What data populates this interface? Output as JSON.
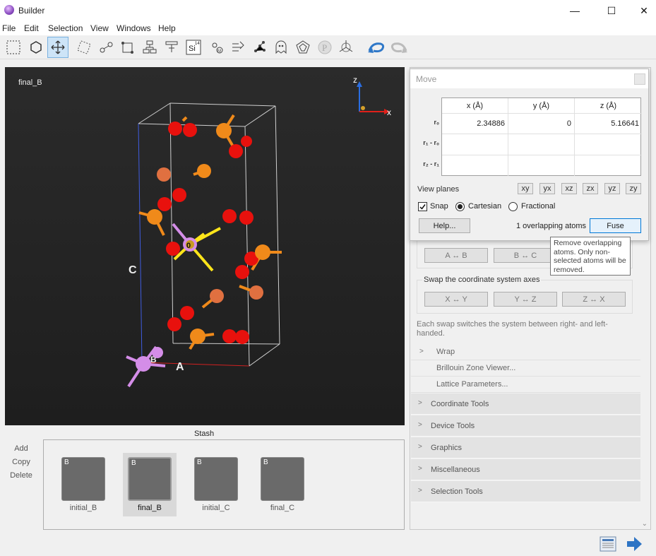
{
  "window": {
    "title": "Builder",
    "minimize": "—",
    "maximize": "☐",
    "close": "✕"
  },
  "menu": [
    "File",
    "Edit",
    "Selection",
    "View",
    "Windows",
    "Help"
  ],
  "toolbar": {
    "icons": [
      "select-rectangle-icon",
      "rotate-icon",
      "move-icon",
      "tag-icon",
      "bond-icon",
      "cell-icon",
      "tree-icon",
      "builder-icon",
      "periodic-table-icon",
      "molecule-icon",
      "transform-icon",
      "graph-icon",
      "ghost-icon",
      "crystal-icon",
      "quantum-icon",
      "axes-icon",
      "undo-icon",
      "redo-icon"
    ],
    "element_symbol": "Si",
    "element_number": "14"
  },
  "viewport": {
    "label": "final_B",
    "axis_z": "z",
    "axis_x": "x",
    "lattice_c": "C",
    "lattice_a": "A",
    "lattice_b": "B",
    "origin_label": "0"
  },
  "stash": {
    "title": "Stash",
    "actions": [
      "Add",
      "Copy",
      "Delete"
    ],
    "items": [
      {
        "name": "initial_B",
        "badge": "B",
        "selected": false
      },
      {
        "name": "final_B",
        "badge": "B",
        "selected": true
      },
      {
        "name": "initial_C",
        "badge": "B",
        "selected": false
      },
      {
        "name": "final_C",
        "badge": "B",
        "selected": false
      }
    ]
  },
  "move_dialog": {
    "title": "Move",
    "columns": [
      "x (Å)",
      "y (Å)",
      "z (Å)"
    ],
    "rows": [
      {
        "label": "r₀",
        "values": [
          "2.34886",
          "0",
          "5.16641"
        ]
      },
      {
        "label": "r₁ - r₀",
        "values": [
          "",
          "",
          ""
        ]
      },
      {
        "label": "r₂ - r₁",
        "values": [
          "",
          "",
          ""
        ]
      }
    ],
    "view_planes_label": "View planes",
    "view_planes": [
      "xy",
      "yx",
      "xz",
      "zx",
      "yz",
      "zy"
    ],
    "snap_label": "Snap",
    "snap_checked": true,
    "cartesian_label": "Cartesian",
    "fractional_label": "Fractional",
    "coordinate_mode": "Cartesian",
    "help_button": "Help...",
    "overlap_text": "1 overlapping atoms",
    "fuse_button": "Fuse"
  },
  "tooltip": {
    "text": "Remove overlapping atoms. Only non-selected atoms will be removed."
  },
  "right_panel": {
    "swap_lattice": [
      "A ↔ B",
      "B ↔ C"
    ],
    "swap_axes_title": "Swap the coordinate system axes",
    "swap_axes": [
      "X ↔ Y",
      "Y ↔ Z",
      "Z ↔ X"
    ],
    "swap_hint": "Each swap switches the system between right- and left-handed.",
    "subitems": [
      "Wrap",
      "Brillouin Zone Viewer...",
      "Lattice Parameters..."
    ],
    "sections": [
      "Coordinate Tools",
      "Device Tools",
      "Graphics",
      "Miscellaneous",
      "Selection Tools"
    ]
  },
  "colors": {
    "accent": "#0078d7",
    "atom_oxygen": "#e8110d",
    "atom_phosphorus": "#f08a1a",
    "atom_boron": "#d48de8",
    "selection_yellow": "#ffe51a"
  }
}
